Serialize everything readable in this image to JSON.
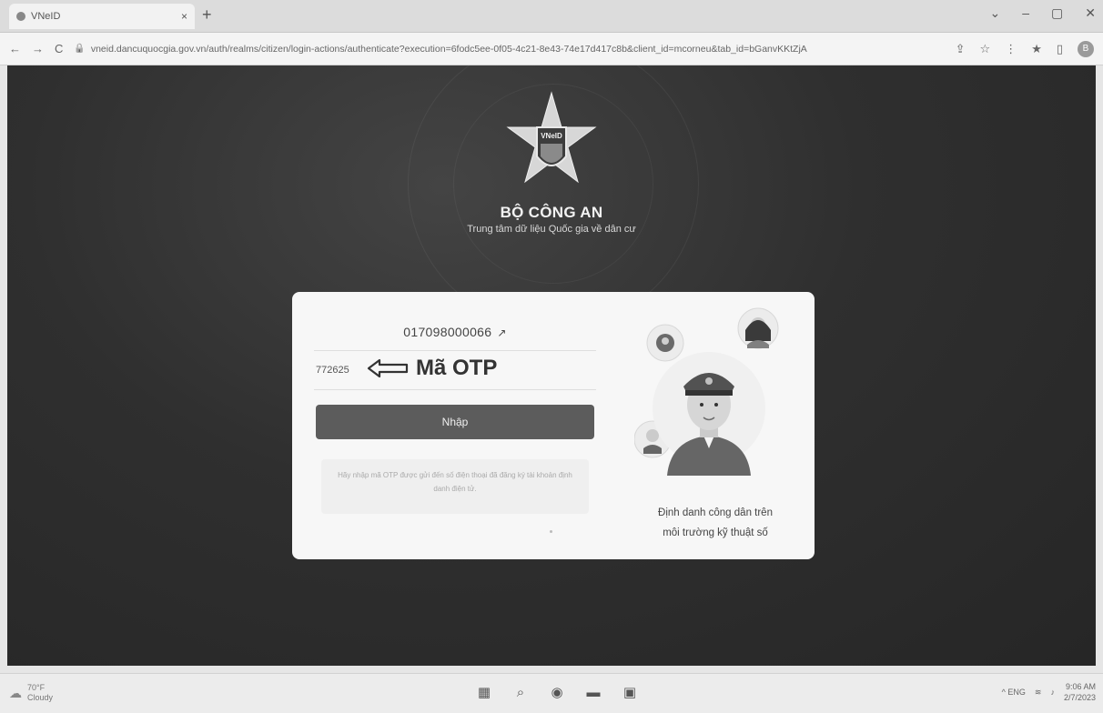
{
  "browser": {
    "tab_title": "VNeID",
    "tab_close": "×",
    "new_tab": "+",
    "window_controls": [
      "⌄",
      "–",
      "▢",
      "✕"
    ],
    "url": "vneid.dancuquocgia.gov.vn/auth/realms/citizen/login-actions/authenticate?execution=6fodc5ee-0f05-4c21-8e43-74e17d417c8b&client_id=mcorneu&tab_id=bGanvKKtZjA",
    "back": "←",
    "forward": "→",
    "reload": "C",
    "toolbar_icons": [
      "⇪",
      "☆",
      "⋮",
      "★",
      "▯"
    ],
    "profile_initial": "B"
  },
  "header": {
    "emblem_label": "VNeID",
    "org_name": "BỘ CÔNG AN",
    "org_subtitle": "Trung tâm dữ liệu Quốc gia về dân cư"
  },
  "login": {
    "id_number": "017098000066",
    "edit_icon": "↗",
    "otp_value": "772625",
    "otp_annotation": "Mã OTP",
    "submit_label": "Nhập",
    "hint": "Hãy nhập mã OTP được gửi đến số điện thoại đã đăng ký tài khoản định danh điện tử."
  },
  "promo": {
    "line1": "Định danh công dân trên",
    "line2": "môi trường kỹ thuật số"
  },
  "taskbar": {
    "temperature": "70°F",
    "weather": "Cloudy",
    "tray_text": "^  ENG",
    "time": "9:06 AM",
    "date": "2/7/2023"
  }
}
